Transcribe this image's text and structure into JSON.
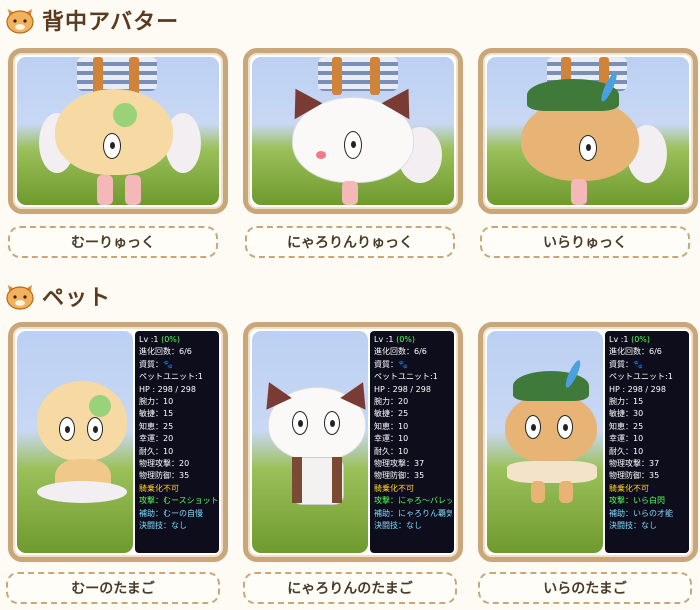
{
  "sections": {
    "backpack_title": "背中アバター",
    "pet_title": "ペット"
  },
  "backpacks": [
    {
      "name": "むーりゅっく"
    },
    {
      "name": "にゃろりんりゅっく"
    },
    {
      "name": "いらりゅっく"
    }
  ],
  "pets": [
    {
      "name": "むーのたまご",
      "lv": "Lv :1",
      "lv_pct": "(0%)",
      "evolve": "進化回数：6/6",
      "quality": "資質：",
      "quality_icon": "paw-icon",
      "unit": "ペットユニット:1",
      "hp": "HP : 298 / 298",
      "str": "腕力：10",
      "agi": "敏捷：15",
      "int": "知恵：25",
      "luck": "幸運：20",
      "dur": "耐久：10",
      "atk": "物理攻撃：20",
      "def": "物理防御：35",
      "ride": "騎乗化不可",
      "attack_skill": "攻撃：むースショット",
      "support_skill": "補助：むーの自慢",
      "final_skill": "決闘技：なし"
    },
    {
      "name": "にゃろりんのたまご",
      "lv": "Lv :1",
      "lv_pct": "(0%)",
      "evolve": "進化回数：6/6",
      "quality": "資質：",
      "quality_icon": "paw-icon",
      "unit": "ペットユニット:1",
      "hp": "HP : 298 / 298",
      "str": "腕力：20",
      "agi": "敏捷：25",
      "int": "知恵：10",
      "luck": "幸運：10",
      "dur": "耐久：10",
      "atk": "物理攻撃：37",
      "def": "物理防御：35",
      "ride": "騎乗化不可",
      "attack_skill": "攻撃：にゃろ～バレット",
      "support_skill": "補助：にゃろりん覇気",
      "final_skill": "決闘技：なし"
    },
    {
      "name": "いらのたまご",
      "lv": "Lv :1",
      "lv_pct": "(0%)",
      "evolve": "進化回数：6/6",
      "quality": "資質：",
      "quality_icon": "paw-icon",
      "unit": "ペットユニット:1",
      "hp": "HP : 298 / 298",
      "str": "腕力：15",
      "agi": "敏捷：30",
      "int": "知恵：25",
      "luck": "幸運：10",
      "dur": "耐久：10",
      "atk": "物理攻撃：37",
      "def": "物理防御：35",
      "ride": "騎乗化不可",
      "attack_skill": "攻撃：いら白閃",
      "support_skill": "補助：いらの才能",
      "final_skill": "決闘技：なし"
    }
  ],
  "colors": {
    "frame": "#c9a77a",
    "stats_bg": "#0d0d1c",
    "green": "#55ff55",
    "yellow": "#ffd21a",
    "cyan": "#7fdcff"
  }
}
